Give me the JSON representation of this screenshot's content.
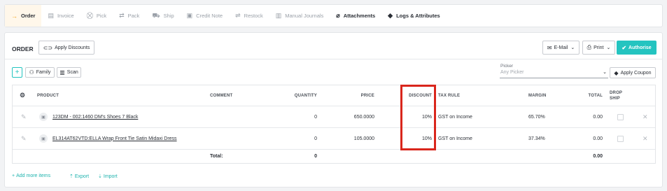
{
  "tabs": [
    {
      "label": "Order",
      "icon": "arrow-right-icon",
      "glyph": "→"
    },
    {
      "label": "Invoice",
      "icon": "invoice-icon",
      "glyph": "▤"
    },
    {
      "label": "Pick",
      "icon": "pick-icon",
      "glyph": "⛒"
    },
    {
      "label": "Pack",
      "icon": "pack-icon",
      "glyph": "⇄"
    },
    {
      "label": "Ship",
      "icon": "ship-icon",
      "glyph": "⛟"
    },
    {
      "label": "Credit Note",
      "icon": "credit-note-icon",
      "glyph": "▣"
    },
    {
      "label": "Restock",
      "icon": "restock-icon",
      "glyph": "⇌"
    },
    {
      "label": "Manual Journals",
      "icon": "journal-icon",
      "glyph": "▥"
    },
    {
      "label": "Attachments",
      "icon": "paperclip-icon",
      "glyph": "⌀"
    },
    {
      "label": "Logs & Attributes",
      "icon": "tag-icon",
      "glyph": "◆"
    }
  ],
  "order": {
    "title": "ORDER",
    "apply_discounts": "Apply Discounts",
    "email": "E-Mail",
    "print": "Print",
    "authorise": "Authorise"
  },
  "toolbar": {
    "add": "+",
    "family": "Family",
    "scan": "Scan",
    "picker_label": "Picker",
    "picker_placeholder": "Any Picker",
    "apply_coupon": "Apply Coupon"
  },
  "columns": {
    "product": "PRODUCT",
    "comment": "COMMENT",
    "quantity": "QUANTITY",
    "price": "PRICE",
    "discount": "DISCOUNT",
    "tax_rule": "TAX RULE",
    "margin": "MARGIN",
    "total": "TOTAL",
    "drop_ship_1": "DROP",
    "drop_ship_2": "SHIP"
  },
  "rows": [
    {
      "product": "123DM - 002:1460 DM's Shoes 7 Black",
      "comment": "",
      "quantity": "0",
      "price": "650.0000",
      "discount": "10%",
      "tax_rule": "GST on Income",
      "margin": "65.70%",
      "total": "0.00"
    },
    {
      "product": "EL314AT62VTD:ELLA Wrap Front Tie Satin Midaxi Dress",
      "comment": "",
      "quantity": "0",
      "price": "105.0000",
      "discount": "10%",
      "tax_rule": "GST on Income",
      "margin": "37.34%",
      "total": "0.00"
    }
  ],
  "totals": {
    "label": "Total:",
    "quantity": "0",
    "total": "0.00"
  },
  "footer": {
    "add_more": "Add more items",
    "export": "Export",
    "import": "Import"
  },
  "colors": {
    "accent": "#24c4c0",
    "active_tab_bg": "#fff7ea",
    "highlight": "#d9261c"
  }
}
